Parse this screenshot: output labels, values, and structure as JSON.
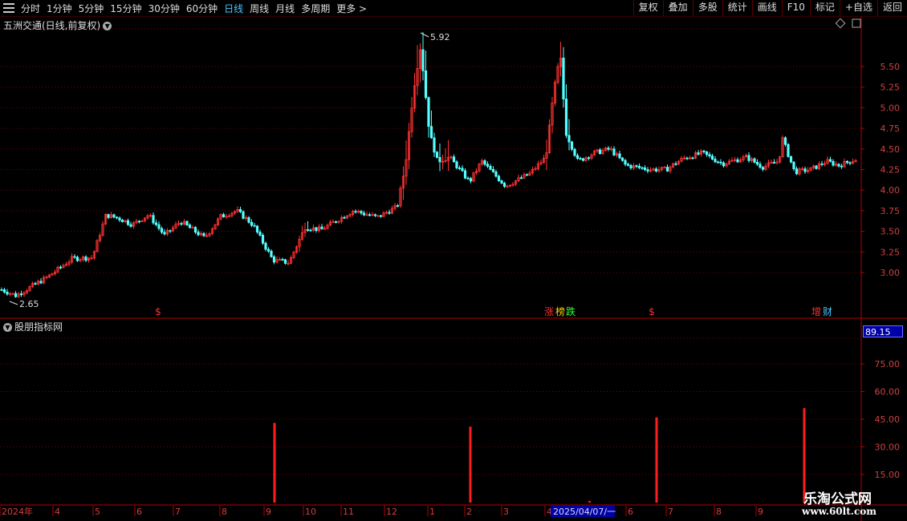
{
  "toolbar": {
    "periods": [
      "分时",
      "1分钟",
      "5分钟",
      "15分钟",
      "30分钟",
      "60分钟",
      "日线",
      "周线",
      "月线",
      "多周期",
      "更多 >"
    ],
    "active_period": "日线",
    "right_tools": [
      "复权",
      "叠加",
      "多股",
      "统计",
      "画线",
      "F10",
      "标记",
      "+自选",
      "返回"
    ]
  },
  "chart": {
    "title": "五洲交通(日线,前复权)",
    "high_label": "5.92",
    "low_label": "2.65",
    "price_ticks": [
      "5.50",
      "5.25",
      "5.00",
      "4.75",
      "4.50",
      "4.25",
      "4.00",
      "3.75",
      "3.50",
      "3.25",
      "3.00"
    ],
    "markers": [
      {
        "text": "$",
        "color": "#ff3030"
      },
      {
        "text": "涨",
        "color": "#ff3030"
      },
      {
        "text": "榜",
        "color": "#ffd200"
      },
      {
        "text": "跌",
        "color": "#33ff33"
      },
      {
        "text": "$",
        "color": "#ff3030"
      },
      {
        "text": "增",
        "color": "#ff3030"
      },
      {
        "text": "财",
        "color": "#46c8ff"
      }
    ]
  },
  "indicator": {
    "title": "股朋指标网",
    "current_value": "89.15",
    "ticks": [
      "75.00",
      "60.00",
      "45.00",
      "30.00",
      "15.00"
    ],
    "bars": [
      {
        "date_label": "9",
        "value": 43
      },
      {
        "date_label": "2",
        "value": 41
      },
      {
        "date_label": "6",
        "value": 46
      },
      {
        "date_label": "9",
        "value": 51
      }
    ]
  },
  "time_axis": {
    "labels": [
      "2024年",
      "4",
      "5",
      "6",
      "7",
      "8",
      "9",
      "10",
      "11",
      "12",
      "1",
      "2",
      "3",
      "4",
      "5",
      "6",
      "7",
      "8",
      "9"
    ],
    "cursor_label": "2025/04/07/一"
  },
  "watermark": {
    "title": "乐淘公式网",
    "url": "www.60lt.com"
  },
  "colors": {
    "up": "#ff3232",
    "down": "#54ffff",
    "axis": "#b40000",
    "grid": "#7a0000",
    "bar": "#ff1e1e"
  }
}
